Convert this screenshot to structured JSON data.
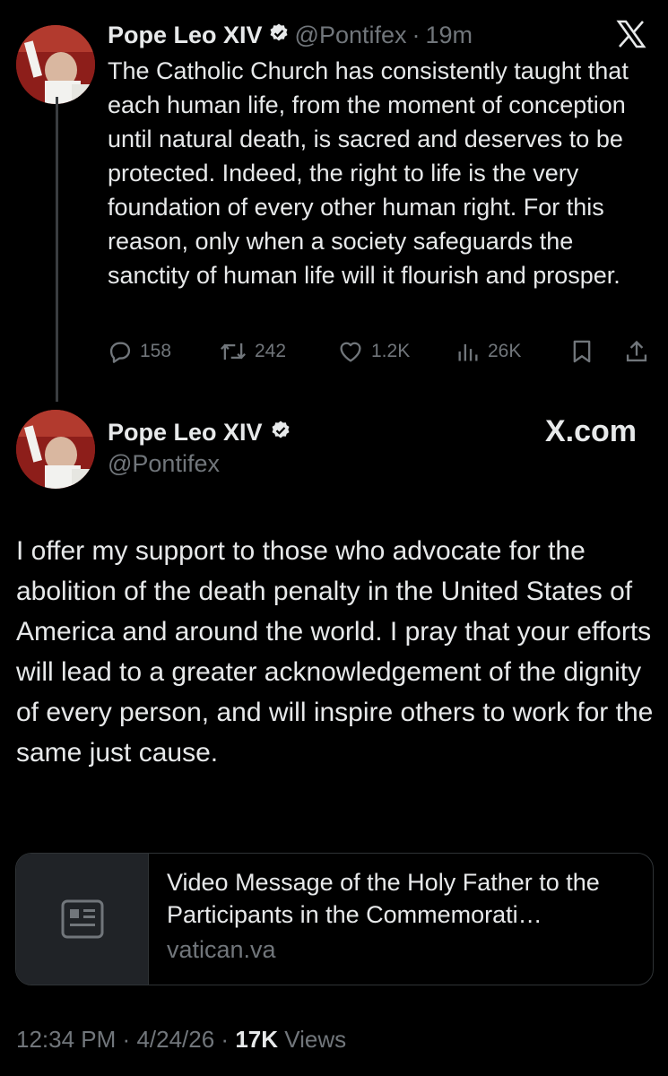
{
  "tweet1": {
    "name": "Pope Leo XIV",
    "handle": "@Pontifex",
    "separator": "·",
    "time": "19m",
    "text": "The Catholic Church has consistently taught that each human life, from the moment of conception until natural death, is sacred and deserves to be protected.  Indeed, the right to life is the very foundation of every other human right.  For this reason, only when a society safeguards the sanctity of human life will it flourish and prosper.",
    "actions": {
      "replies": "158",
      "reposts": "242",
      "likes": "1.2K",
      "views": "26K"
    },
    "brand_icon": "x-logo-icon"
  },
  "tweet2": {
    "name": "Pope Leo XIV",
    "handle": "@Pontifex",
    "brand": "X.com",
    "text": "I offer my support to those who advocate for the abolition of the death penalty in the United States of America and around the world.  I pray that your efforts will lead to a greater acknowledgement of the dignity of every person, and will inspire others to work for the same just cause.",
    "card": {
      "title": "Video Message of the Holy Father to the Participants in the Commemorati…",
      "domain": "vatican.va",
      "icon": "article-icon"
    },
    "footer": {
      "time": "12:34 PM",
      "date": "4/24/26",
      "views_count": "17K",
      "views_label": "Views",
      "separator": "·"
    }
  },
  "colors": {
    "background": "#000000",
    "text": "#e7e9ea",
    "secondary": "#71767b",
    "border": "#2f3336"
  }
}
